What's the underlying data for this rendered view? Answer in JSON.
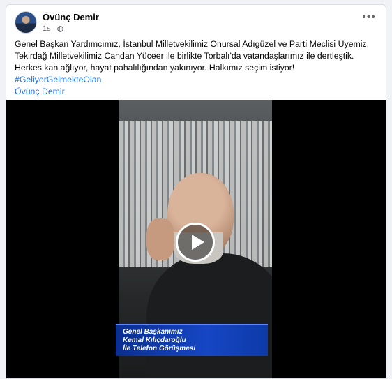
{
  "post": {
    "author": "Övünç Demir",
    "time": "1s",
    "more_icon": "more-horizontal-icon",
    "privacy_icon": "globe-icon",
    "text": "Genel Başkan Yardımcımız, İstanbul Milletvekilimiz Onursal Adıgüzel ve Parti Meclisi Üyemiz, Tekirdağ Milletvekilimiz Candan Yüceer ile birlikte Torbalı'da vatandaşlarımız ile dertleştik. Herkes kan ağlıyor, hayat pahalılığından yakınıyor. Halkımız seçim istiyor!",
    "hashtag": "#GeliyorGelmekteOlan",
    "tag": "Övünç Demir"
  },
  "video": {
    "play_icon": "play-icon",
    "caption_line1": "Genel Başkanımız",
    "caption_line2": "Kemal Kılıçdaroğlu",
    "caption_line3": "İle Telefon Görüşmesi"
  },
  "colors": {
    "link": "#216fdb",
    "caption_bg": "#1646c4",
    "page_bg": "#f0f2f5"
  }
}
